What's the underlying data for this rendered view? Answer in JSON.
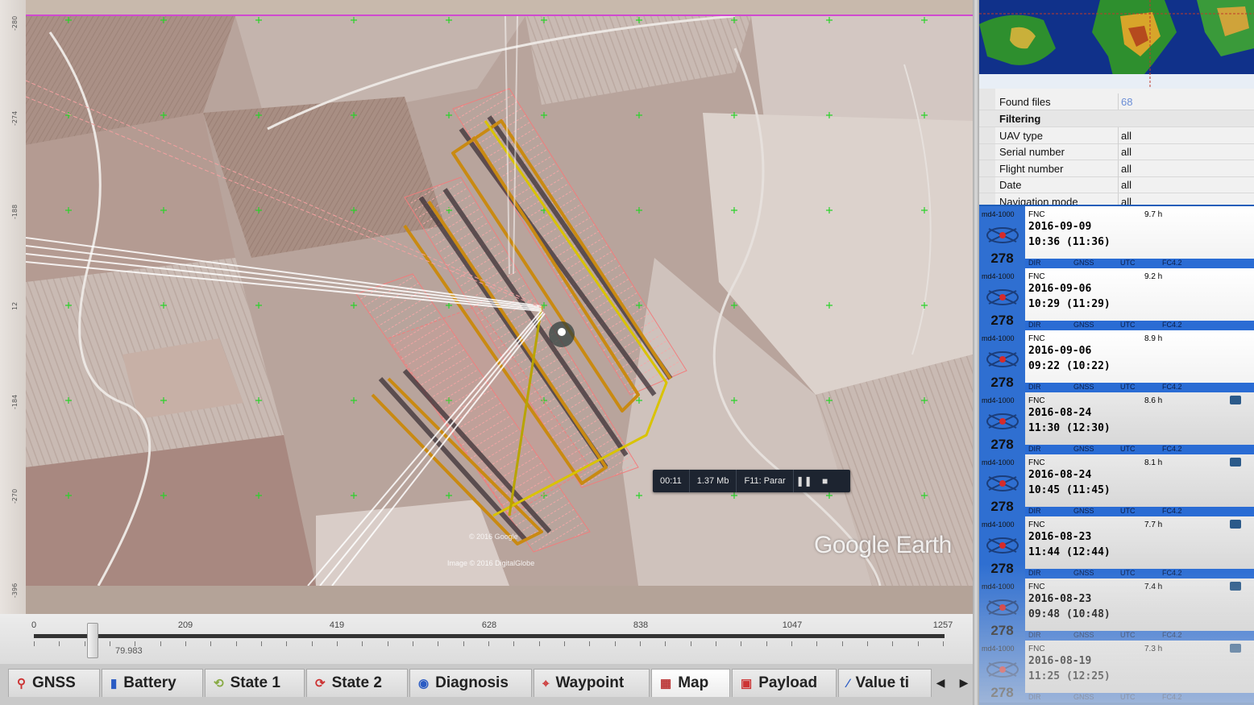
{
  "map": {
    "ruler_labels": [
      "-280",
      "-274",
      "-188",
      "12",
      "-184",
      "-270",
      "-396"
    ],
    "recorder": {
      "elapsed": "00:11",
      "size": "1.37 Mb",
      "shortcut": "F11: Parar"
    },
    "logo": "Google Earth",
    "credit": "Image © 2016 DigitalGlobe",
    "copyright": "© 2016 Google"
  },
  "timeline": {
    "ticks": [
      "0",
      "209",
      "419",
      "628",
      "838",
      "1047",
      "1257"
    ],
    "current_value": "79.983"
  },
  "tabs": [
    {
      "label": "GNSS",
      "icon": "satellite-icon"
    },
    {
      "label": "Battery",
      "icon": "battery-icon"
    },
    {
      "label": "State 1",
      "icon": "state-icon"
    },
    {
      "label": "State 2",
      "icon": "state-icon"
    },
    {
      "label": "Diagnosis",
      "icon": "diagnosis-icon"
    },
    {
      "label": "Waypoint",
      "icon": "waypoint-icon"
    },
    {
      "label": "Map",
      "icon": "map-icon"
    },
    {
      "label": "Payload",
      "icon": "payload-icon"
    },
    {
      "label": "Value ti",
      "icon": "value-icon"
    }
  ],
  "props": {
    "found_files_label": "Found files",
    "found_files_value": "68",
    "filtering_label": "Filtering",
    "rows": [
      {
        "k": "UAV type",
        "v": "all"
      },
      {
        "k": "Serial number",
        "v": "all"
      },
      {
        "k": "Flight number",
        "v": "all"
      },
      {
        "k": "Date",
        "v": "all"
      },
      {
        "k": "Navigation mode",
        "v": "all"
      }
    ]
  },
  "flights": [
    {
      "model": "md4-1000",
      "num": "278",
      "fnc": "FNC",
      "dur": "9.7 h",
      "date": "2016-09-09",
      "time": "10:36 (11:36)",
      "tags": [
        "DIR",
        "GNSS",
        "UTC",
        "FC4.2"
      ],
      "cam": false
    },
    {
      "model": "md4-1000",
      "num": "278",
      "fnc": "FNC",
      "dur": "9.2 h",
      "date": "2016-09-06",
      "time": "10:29 (11:29)",
      "tags": [
        "DIR",
        "GNSS",
        "UTC",
        "FC4.2"
      ],
      "cam": false
    },
    {
      "model": "md4-1000",
      "num": "278",
      "fnc": "FNC",
      "dur": "8.9 h",
      "date": "2016-09-06",
      "time": "09:22 (10:22)",
      "tags": [
        "DIR",
        "GNSS",
        "UTC",
        "FC4.2"
      ],
      "cam": false
    },
    {
      "model": "md4-1000",
      "num": "278",
      "fnc": "FNC",
      "dur": "8.6 h",
      "date": "2016-08-24",
      "time": "11:30 (12:30)",
      "tags": [
        "DIR",
        "GNSS",
        "UTC",
        "FC4.2"
      ],
      "cam": true
    },
    {
      "model": "md4-1000",
      "num": "278",
      "fnc": "FNC",
      "dur": "8.1 h",
      "date": "2016-08-24",
      "time": "10:45 (11:45)",
      "tags": [
        "DIR",
        "GNSS",
        "UTC",
        "FC4.2"
      ],
      "cam": true
    },
    {
      "model": "md4-1000",
      "num": "278",
      "fnc": "FNC",
      "dur": "7.7 h",
      "date": "2016-08-23",
      "time": "11:44 (12:44)",
      "tags": [
        "DIR",
        "GNSS",
        "UTC",
        "FC4.2"
      ],
      "cam": true
    },
    {
      "model": "md4-1000",
      "num": "278",
      "fnc": "FNC",
      "dur": "7.4 h",
      "date": "2016-08-23",
      "time": "09:48 (10:48)",
      "tags": [
        "DIR",
        "GNSS",
        "UTC",
        "FC4.2"
      ],
      "cam": true
    },
    {
      "model": "md4-1000",
      "num": "278",
      "fnc": "FNC",
      "dur": "7.3 h",
      "date": "2016-08-19",
      "time": "11:25 (12:25)",
      "tags": [
        "DIR",
        "GNSS",
        "UTC",
        "FC4.2"
      ],
      "cam": true
    }
  ],
  "colors": {
    "accent": "#2a6cd4",
    "flight_path": "#d9b400",
    "footprint": "#f07a7a",
    "grid_cross": "#2bd22b"
  }
}
